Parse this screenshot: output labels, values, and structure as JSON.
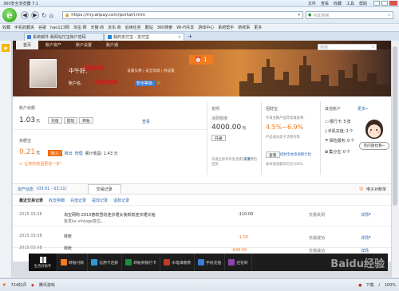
{
  "browser": {
    "title": "360安全浏览器 7.1",
    "menu": [
      "文件",
      "查看",
      "收藏",
      "工具",
      "帮助"
    ],
    "url": "https://my.alipay.com/portal/i.htm",
    "search_placeholder": "点此搜索",
    "bookmarks": [
      "收藏",
      "手机收藏夹",
      "谷歌",
      "hao123网",
      "淘宝·网",
      "天猫·商",
      "京东·商",
      "后续任务",
      "酷站",
      "360搜索",
      "Wi-Fi共享",
      "游戏中心",
      "系统帮手",
      "新鲜事",
      "更多"
    ],
    "tabs": [
      {
        "label": "系统邮件-我网站付宝账户密码",
        "active": false
      },
      {
        "label": "我的支付宝 - 支付宝",
        "active": true
      }
    ]
  },
  "alipay": {
    "nav": [
      "首页",
      "账户资产",
      "账户设置",
      "账户通"
    ],
    "search_placeholder": "搜索",
    "greeting": "中午好,",
    "greeting_suffix": "设置头像 | 安全等级 | 待设置",
    "account_label": "账户名:",
    "security_label": "安全等级:",
    "security_value": "中",
    "message_count": "1",
    "balance": {
      "title": "账户余额",
      "amount": "1.03",
      "unit": "元",
      "buttons": [
        "充值",
        "提现",
        "转账"
      ],
      "view": "查看"
    },
    "yuebao": {
      "title": "余额宝",
      "amount": "0.21",
      "unit": "元",
      "buttons": [
        "转入",
        "转出",
        "管理"
      ],
      "earnings": "累计收益: 1.43 元",
      "tip": "让你的收益更进一步!"
    },
    "huabei": {
      "title": "花呗",
      "limit_label": "消费额度:",
      "limit": "4000.00",
      "unit": "元",
      "button": "开通",
      "note": "开通立即享有免息期,先消费后还款",
      "more": "详情"
    },
    "zhaocaibao": {
      "title": "招财宝",
      "desc": "今日主推产品年化收益率:",
      "rate": "4.5%~6.9%",
      "sub": "产品收益高于活期存款",
      "button": "查看",
      "link": "招财宝本息保障计划",
      "guarantee": "保本保息最高可达100%"
    },
    "other": {
      "title": "其他账户",
      "more": "更多»",
      "items": [
        {
          "icon": "bank-card-icon",
          "label": "银行卡:",
          "value": "5",
          "unit": "张",
          "action": "管理"
        },
        {
          "icon": "phone-icon",
          "label": "手机充值:",
          "value": "2",
          "unit": "个"
        },
        {
          "icon": "umbrella-icon",
          "label": "保险服务:",
          "value": "0",
          "unit": "个"
        },
        {
          "icon": "gift-icon",
          "label": "集分宝:",
          "value": "0",
          "unit": "个"
        }
      ]
    },
    "help_widget": "有问题找我~",
    "records": {
      "tabs": [
        "资产动态",
        "(03.01 - 03.11)",
        "交易记录"
      ],
      "top_right": "电子对账单",
      "filters": [
        "最近交易记录",
        "收支明细",
        "充值记录",
        "提现记录",
        "退款记录"
      ],
      "rows": [
        {
          "date": "2015.03.08",
          "name": "淘宝网购-2015春款雪纺连衣裙女装新款连衣裙长袖",
          "name2": "批发ka vintage复古...",
          "amount": "-110.00",
          "amount_color": "#333333",
          "status": "交易关闭",
          "action": "详情"
        },
        {
          "date": "2015.03.08",
          "name": "转账",
          "name2": "",
          "amount": "-1.00",
          "amount_color": "#f47a20",
          "status": "交易成功",
          "action": "详情"
        },
        {
          "date": "2015.03.08",
          "name": "转账",
          "name2": "",
          "amount": "-849.00",
          "amount_color": "#f47a20",
          "status": "交易成功",
          "action": "详情"
        }
      ]
    }
  },
  "dock": {
    "home": "生活好助手",
    "items": [
      {
        "label": "转账付款",
        "color": "#f47a20"
      },
      {
        "label": "信用卡还款",
        "color": "#2e9ad0"
      },
      {
        "label": "转账到银行卡",
        "color": "#1c8f3c"
      },
      {
        "label": "水电煤缴费",
        "color": "#c0392b"
      },
      {
        "label": "手机充值",
        "color": "#3b7dd8"
      },
      {
        "label": "还花呗",
        "color": "#8e44ad"
      }
    ]
  },
  "status": {
    "left": "724好评",
    "middle": "腾讯游戏",
    "zoom": "100%",
    "right_label": "下载"
  },
  "watermark": "Baidu经验"
}
